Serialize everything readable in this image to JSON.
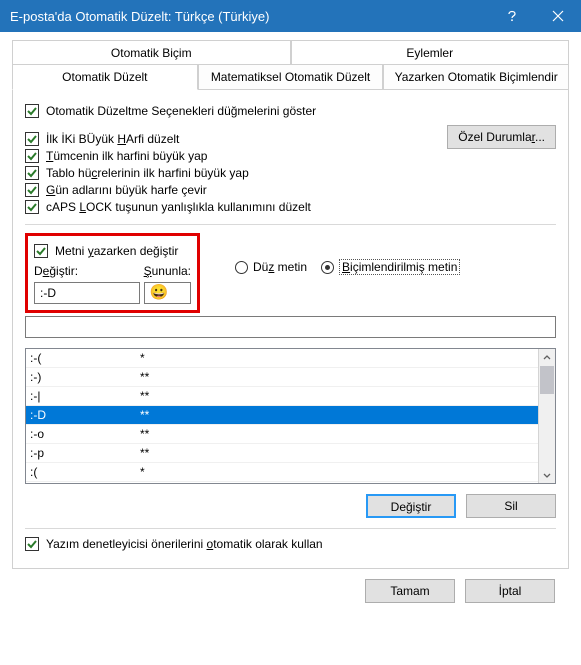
{
  "title": "E-posta'da Otomatik Düzelt: Türkçe (Türkiye)",
  "tabs_top": [
    "Otomatik Biçim",
    "Eylemler"
  ],
  "tabs_bottom": [
    "Otomatik Düzelt",
    "Matematiksel Otomatik Düzelt",
    "Yazarken Otomatik Biçimlendir"
  ],
  "checkboxes": {
    "show_buttons": "Otomatik Düzeltme Seçenekleri düğmelerini göster",
    "two_caps_pre": "İlk İKi BÜyük ",
    "two_caps_u": "H",
    "two_caps_post": "Arfi düzelt",
    "sentence_pre": "",
    "sentence_u": "T",
    "sentence_post": "ümcenin ilk harfini büyük yap",
    "tablecells_pre": "Tablo hü",
    "tablecells_u": "c",
    "tablecells_post": "relerinin ilk harfini büyük yap",
    "days_pre": "",
    "days_u": "G",
    "days_post": "ün adlarını büyük harfe çevir",
    "caps_pre": "cAPS ",
    "caps_u": "L",
    "caps_post": "OCK tuşunun yanlışlıkla kullanımını düzelt",
    "replace_pre": "Metni ",
    "replace_u": "y",
    "replace_post": "azarken değiştir",
    "spell_pre": "Yazım denetleyicisi önerilerini ",
    "spell_u": "o",
    "spell_post": "tomatik olarak kullan"
  },
  "ozel_pre": "Özel Durumla",
  "ozel_u": "r",
  "ozel_post": "...",
  "labels": {
    "degistir_pre": "D",
    "degistir_u": "e",
    "degistir_post": "ğiştir:",
    "sununla_pre": "",
    "sununla_u": "Ş",
    "sununla_post": "ununla:"
  },
  "radios": {
    "plain_pre": "Dü",
    "plain_u": "z",
    "plain_post": " metin",
    "formatted_pre": "",
    "formatted_u": "B",
    "formatted_post": "içimlendirilmiş metin"
  },
  "input_replace": ":-D",
  "input_with": "😀",
  "list": [
    {
      "r": ":-(",
      "w": "*"
    },
    {
      "r": ":-)",
      "w": "**"
    },
    {
      "r": ":-|",
      "w": "**"
    },
    {
      "r": ":-D",
      "w": "**",
      "sel": true
    },
    {
      "r": ":-o",
      "w": "**"
    },
    {
      "r": ":-p",
      "w": "**"
    },
    {
      "r": ":(",
      "w": "*"
    }
  ],
  "buttons": {
    "degistir": "Değiştir",
    "sil": "Sil",
    "tamam": "Tamam",
    "iptal": "İptal"
  }
}
